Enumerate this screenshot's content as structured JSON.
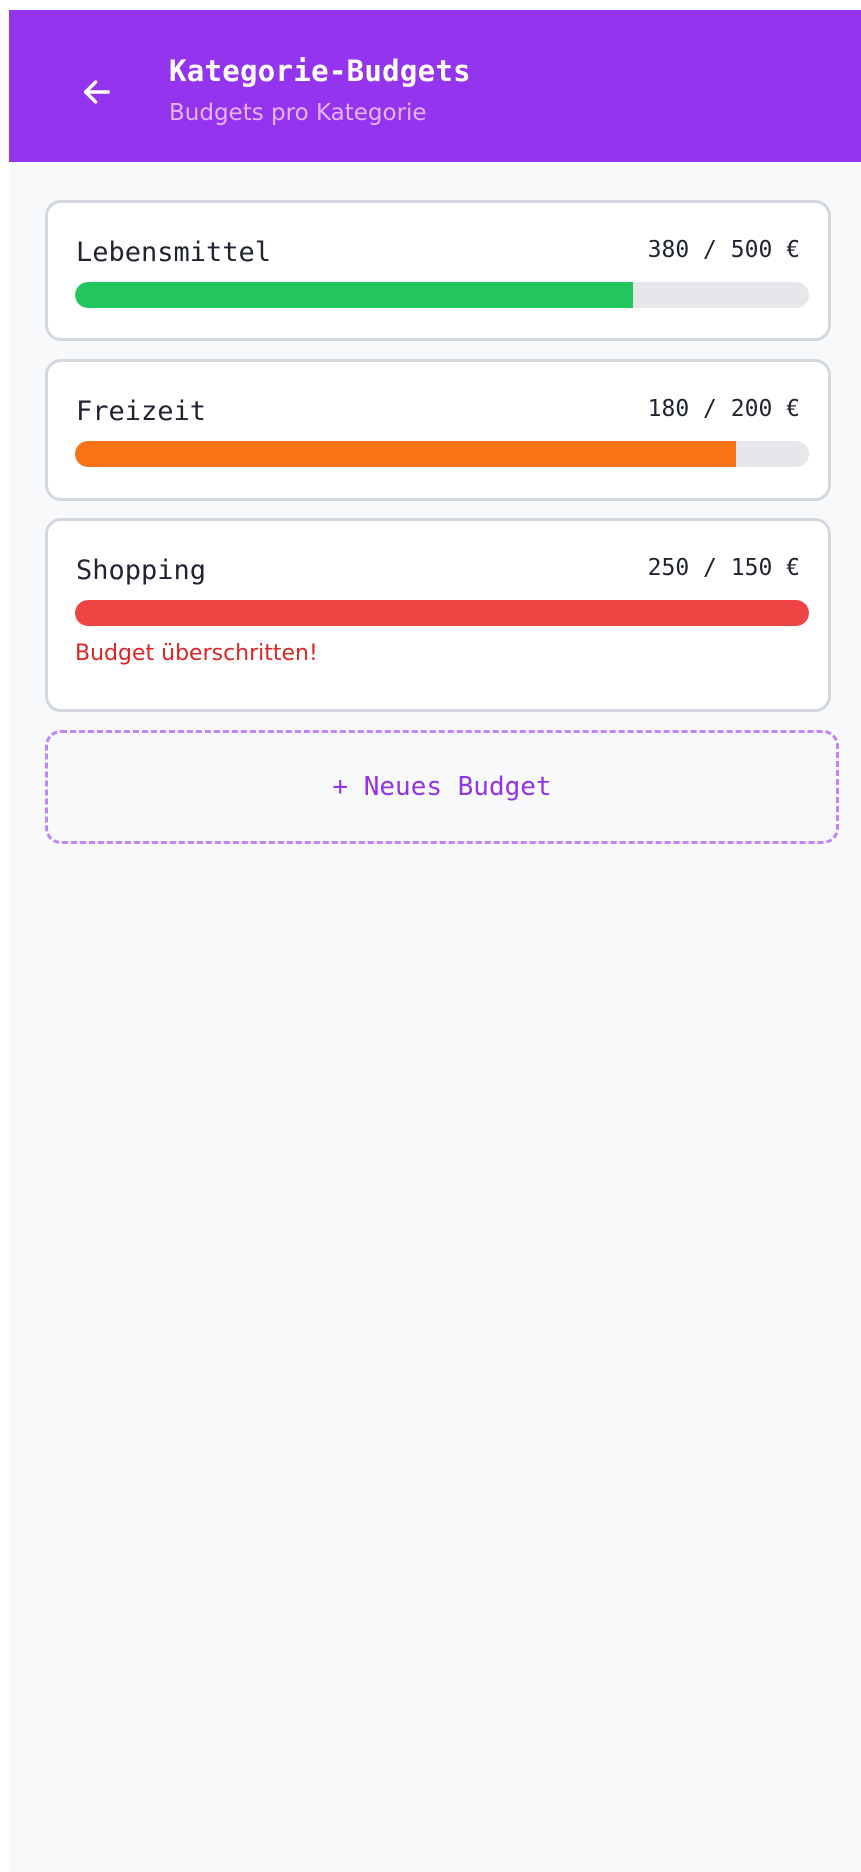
{
  "header": {
    "title": "Kategorie-Budgets",
    "subtitle": "Budgets pro Kategorie",
    "back_icon": "arrow-left-icon",
    "background_color": "#9434ee"
  },
  "budgets": [
    {
      "name": "Lebensmittel",
      "amount": "380 / 500 €",
      "spent": 380,
      "limit": 500,
      "progress": 0.76,
      "color": "#22c55e",
      "warning": ""
    },
    {
      "name": "Freizeit",
      "amount": "180 / 200 €",
      "spent": 180,
      "limit": 200,
      "progress": 0.9,
      "color": "#f97316",
      "warning": ""
    },
    {
      "name": "Shopping",
      "amount": "250 / 150 €",
      "spent": 250,
      "limit": 150,
      "progress": 1.0,
      "color": "#ef4444",
      "warning": "Budget überschritten!"
    }
  ],
  "new_budget": {
    "label": "+ Neues Budget",
    "color": "#9333ea"
  }
}
